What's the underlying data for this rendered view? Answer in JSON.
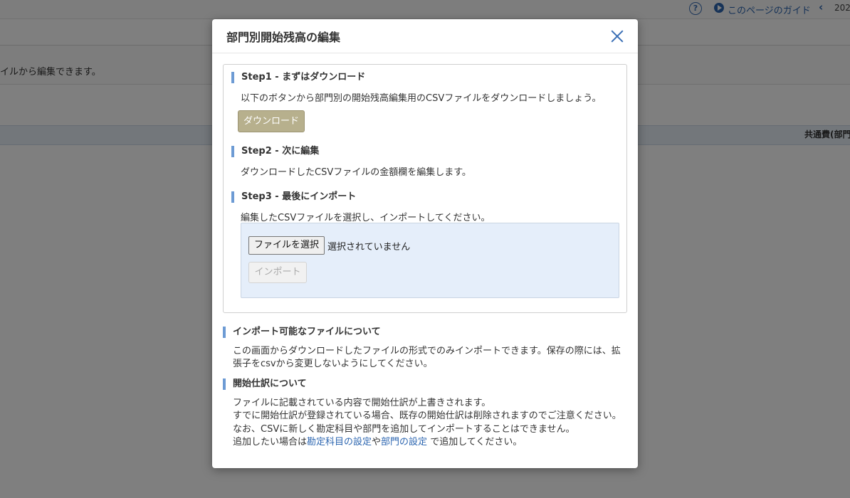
{
  "background": {
    "topbar": {
      "help_icon": "question-circle-icon",
      "help_glyph": "?",
      "guide_icon": "play-circle-icon",
      "guide_label": "このページのガイド",
      "prev_icon": "chevron-left-icon",
      "prev_glyph": "‹",
      "year_partial": "202"
    },
    "description": "イルから編集できます。",
    "column_header": "共通費(部門"
  },
  "modal": {
    "title": "部門別開始残高の編集",
    "close_icon": "close-icon",
    "step1": {
      "heading": "Step1 - まずはダウンロード",
      "text": "以下のボタンから部門別の開始残高編集用のCSVファイルをダウンロードしましょう。",
      "download_label": "ダウンロード"
    },
    "step2": {
      "heading": "Step2 - 次に編集",
      "text": "ダウンロードしたCSVファイルの金額欄を編集します。"
    },
    "step3": {
      "heading": "Step3 - 最後にインポート",
      "text": "編集したCSVファイルを選択し、インポートしてください。",
      "file_button_label": "ファイルを選択",
      "file_status": "選択されていません",
      "import_label": "インポート"
    },
    "importable": {
      "heading": "インポート可能なファイルについて",
      "line1": "この画面からダウンロードしたファイルの形式でのみインポートできます。保存の際には、拡",
      "line2": "張子をcsvから変更しないようにしてください。"
    },
    "opening": {
      "heading": "開始仕訳について",
      "line1": "ファイルに記載されている内容で開始仕訳が上書きされます。",
      "line2": "すでに開始仕訳が登録されている場合、既存の開始仕訳は削除されますのでご注意ください。",
      "line3": "なお、CSVに新しく勘定科目や部門を追加してインポートすることはできません。",
      "line4_prefix": "追加したい場合は",
      "link_accounts": "勘定科目の設定",
      "line4_mid": "や",
      "link_departments": "部門の設定",
      "line4_suffix": " で追加してください。"
    }
  }
}
